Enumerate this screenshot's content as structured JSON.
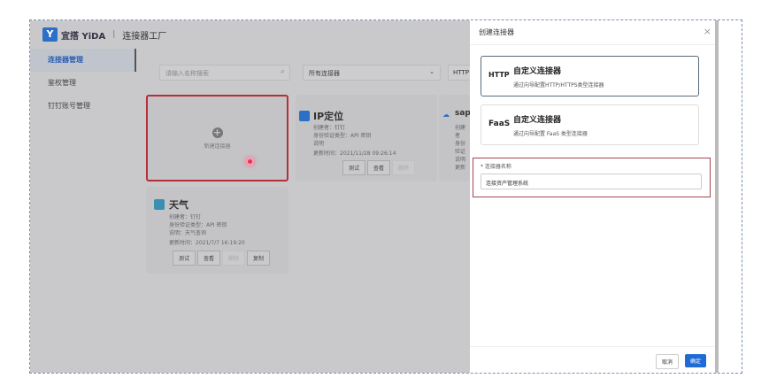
{
  "header": {
    "logo_text": "Y",
    "brand": "宜搭 YiDA",
    "title": "连接器工厂"
  },
  "sidebar": {
    "items": [
      {
        "label": "连接器管理"
      },
      {
        "label": "鉴权管理"
      },
      {
        "label": "钉钉账号管理"
      }
    ]
  },
  "filters": {
    "search_placeholder": "请输入名称搜索",
    "type_select": "所有连接器",
    "protocol_select": "HTTP"
  },
  "add_card": {
    "label": "新建连接器"
  },
  "cards": [
    {
      "title": "IP定位",
      "creator": "创建者：钉钉",
      "auth": "身份验证类型：API 密钥",
      "desc": "说明",
      "updated": "更新时间：2021/11/28 09:26:14",
      "actions": [
        "测试",
        "查看",
        "删除"
      ]
    },
    {
      "title": "sap",
      "creator": "创建者",
      "auth": "身份验证",
      "desc": "说明",
      "updated": "更新"
    },
    {
      "title": "天气",
      "creator": "创建者：钉钉",
      "auth": "身份验证类型：API 密钥",
      "desc": "说明：天气查询",
      "updated": "更新时间：2021/7/7 16:19:20",
      "actions": [
        "测试",
        "查看",
        "删除",
        "复制"
      ]
    }
  ],
  "drawer": {
    "title": "创建连接器",
    "options": [
      {
        "tag": "HTTP",
        "title": "自定义连接器",
        "desc": "通过向导配置HTTP/HTTPS类型连接器"
      },
      {
        "tag": "FaaS",
        "title": "自定义连接器",
        "desc": "通过向导配置 FaaS 类型连接器"
      }
    ],
    "name_label": "* 连接器名称",
    "name_value": "连接资产管理系统",
    "cancel": "取消",
    "ok": "确定"
  }
}
